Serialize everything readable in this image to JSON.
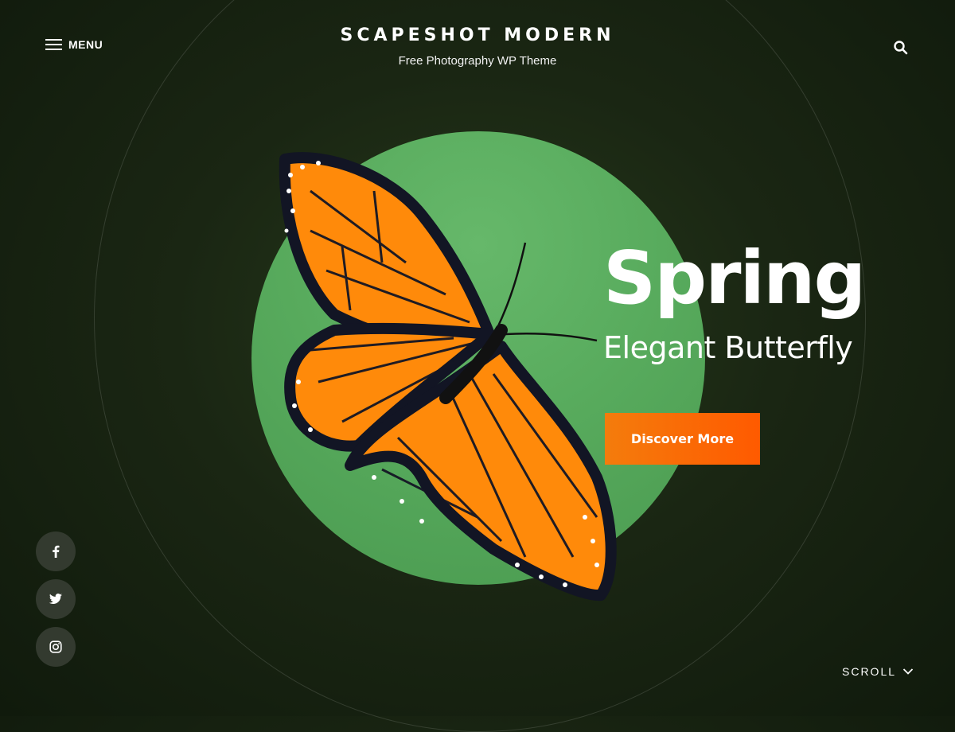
{
  "header": {
    "menu_label": "MENU",
    "site_title": "SCAPESHOT MODERN",
    "tagline": "Free Photography WP Theme",
    "menu_icon": "hamburger-icon",
    "search_icon": "search-icon"
  },
  "hero": {
    "title": "Spring",
    "subtitle": "Elegant Butterfly",
    "cta_label": "Discover More",
    "image_subject": "monarch butterfly",
    "accent_color": "#ff6a00",
    "circle_color": "#5aad5f"
  },
  "social": [
    {
      "icon": "facebook-icon"
    },
    {
      "icon": "twitter-icon"
    },
    {
      "icon": "instagram-icon"
    }
  ],
  "scroll": {
    "label": "SCROLL",
    "icon": "chevron-down-icon"
  }
}
